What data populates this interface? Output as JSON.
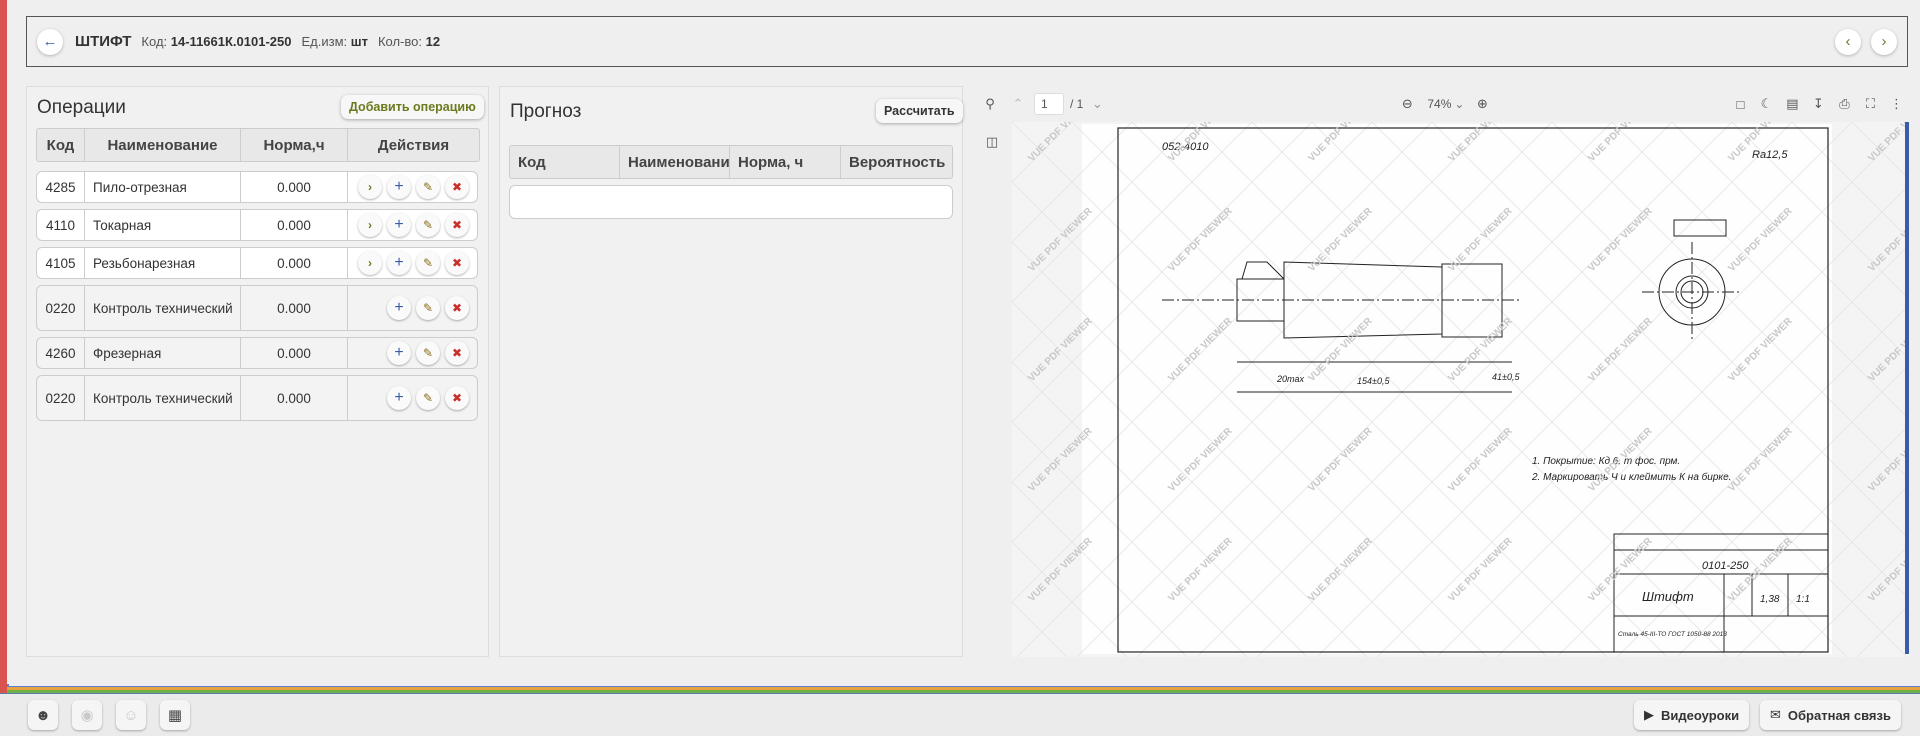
{
  "header": {
    "back_icon": "arrow-left-icon",
    "title": "ШТИФТ",
    "code_label": "Код:",
    "code_value": "14-11661К.0101-250",
    "unit_label": "Ед.изм:",
    "unit_value": "шт",
    "qty_label": "Кол-во:",
    "qty_value": "12",
    "prev_icon": "chevron-left-icon",
    "next_icon": "chevron-right-icon"
  },
  "operations": {
    "title": "Операции",
    "add_button": "Добавить операцию",
    "columns": [
      "Код",
      "Наименование",
      "Норма,ч",
      "Действия"
    ],
    "rows": [
      {
        "code": "4285",
        "name": "Пило-отрезная",
        "norm": "0.000",
        "can_open": true
      },
      {
        "code": "4110",
        "name": "Токарная",
        "norm": "0.000",
        "can_open": true
      },
      {
        "code": "4105",
        "name": "Резьбонарезная",
        "norm": "0.000",
        "can_open": true
      },
      {
        "code": "0220",
        "name": "Контроль технический",
        "norm": "0.000",
        "can_open": false
      },
      {
        "code": "4260",
        "name": "Фрезерная",
        "norm": "0.000",
        "can_open": false
      },
      {
        "code": "0220",
        "name": "Контроль технический",
        "norm": "0.000",
        "can_open": false
      }
    ]
  },
  "forecast": {
    "title": "Прогноз",
    "calc_button": "Рассчитать",
    "columns": [
      "Код",
      "Наименовани",
      "Норма, ч",
      "Вероятность"
    ]
  },
  "pdf": {
    "page_current": "1",
    "page_total": "/ 1",
    "zoom": "74%",
    "watermark": "VUE PDF VIEWER",
    "drawing": {
      "top_left_code": "052-4010",
      "roughness": "Ra12,5",
      "note_1": "1. Покрытие: Кд 6. т фос. прм.",
      "note_2": "2. Маркировать Ч и клеймить К на бирке.",
      "doc_number": "0101-250",
      "part_name": "Штифт",
      "mass": "1,38",
      "scale": "1:1",
      "material": "Сталь 45-III-ТО ГОСТ 1050-88 2013"
    }
  },
  "footer": {
    "video_button": "Видеоуроки",
    "feedback_button": "Обратная связь"
  },
  "colors": {
    "accent": "#3b5bab",
    "add_op": "#6b7a1e",
    "delete": "#c9302c"
  }
}
